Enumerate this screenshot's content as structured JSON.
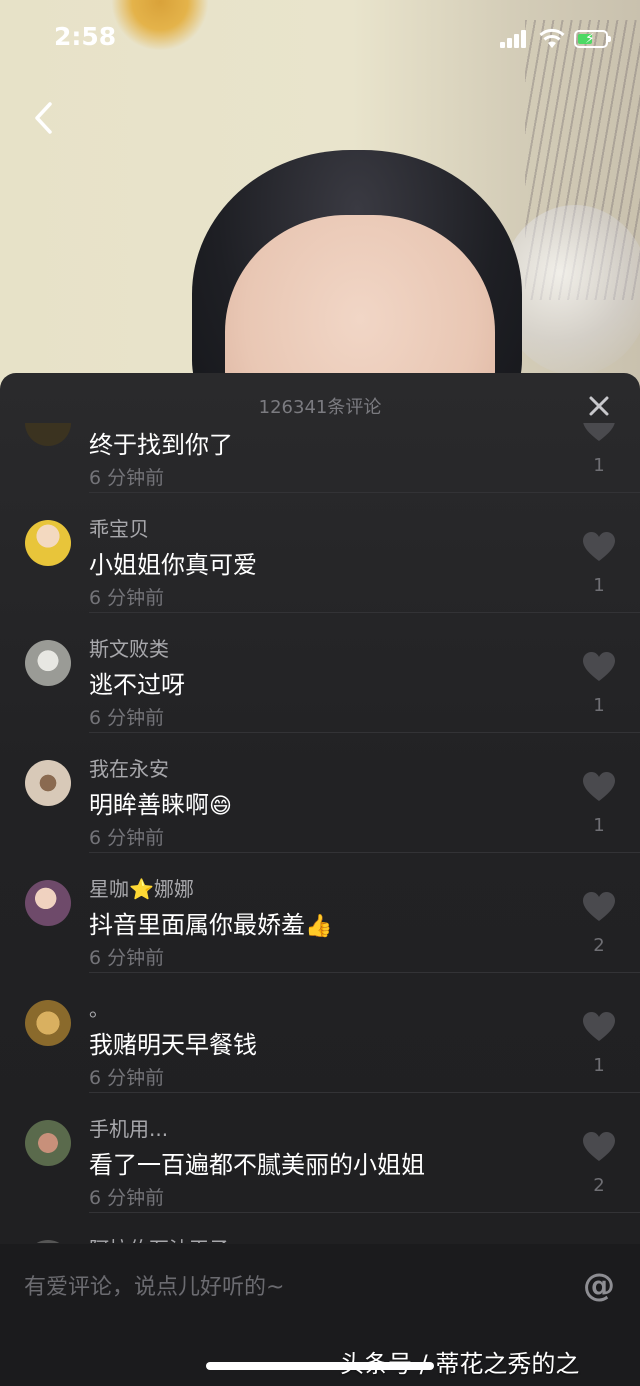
{
  "status_bar": {
    "time": "2:58"
  },
  "panel": {
    "title": "126341条评论"
  },
  "comments": [
    {
      "user": "",
      "text": "终于找到你了",
      "time": "6 分钟前",
      "likes": "1",
      "avatar_color": "#3b3320"
    },
    {
      "user": "乖宝贝",
      "text": "小姐姐你真可爱",
      "time": "6 分钟前",
      "likes": "1",
      "avatar_color": "#e8c53a"
    },
    {
      "user": "斯文败类",
      "text": "逃不过呀",
      "time": "6 分钟前",
      "likes": "1",
      "avatar_color": "#c9cbc6"
    },
    {
      "user": "我在永安",
      "text": "明眸善睐啊",
      "emoji": "😄",
      "time": "6 分钟前",
      "likes": "1",
      "avatar_color": "#d8c9b8"
    },
    {
      "user_prefix": "星咖",
      "user_star": "⭐",
      "user_suffix": "娜娜",
      "text": "抖音里面属你最娇羞",
      "emoji": "👍",
      "time": "6 分钟前",
      "likes": "2",
      "avatar_color": "#6e4a6a"
    },
    {
      "user": "。",
      "text": "我赌明天早餐钱",
      "time": "6 分钟前",
      "likes": "1",
      "avatar_color": "#b28a3c"
    },
    {
      "user": "手机用...",
      "text": "看了一百遍都不腻美丽的小姐姐",
      "time": "6 分钟前",
      "likes": "2",
      "avatar_color": "#7a5a4c"
    },
    {
      "user": "阿拉伯石油王子",
      "text": "",
      "time": "",
      "likes": "",
      "avatar_color": "#555"
    }
  ],
  "input": {
    "placeholder": "有爱评论，说点儿好听的~",
    "at_label": "@"
  },
  "watermark": "头条号 / 蒂花之秀的之",
  "colors": {
    "panel_bg": "#222224",
    "text": "#ffffff",
    "muted": "#737378"
  }
}
